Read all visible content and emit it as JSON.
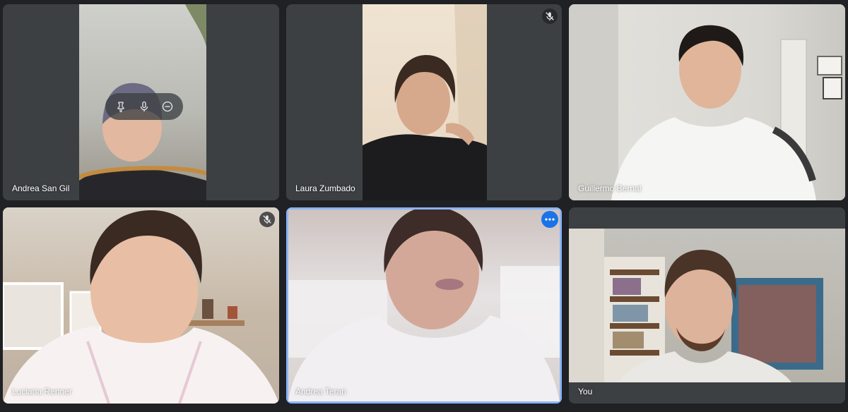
{
  "participants": [
    {
      "name": "Andrea San Gil",
      "muted": false
    },
    {
      "name": "Laura Zumbado",
      "muted": true
    },
    {
      "name": "Guillermo Bernal",
      "muted": false
    },
    {
      "name": "Luciana Renner",
      "muted": true
    },
    {
      "name": "Andrea Teran",
      "muted": false,
      "active": true
    },
    {
      "name": "You",
      "muted": false
    }
  ],
  "hover_controls": [
    "pin-icon",
    "microphone-icon",
    "remove-icon"
  ],
  "colors": {
    "background": "#202124",
    "tile": "#3c4043",
    "accent": "#1a73e8",
    "active_border": "#8ab4f8"
  }
}
